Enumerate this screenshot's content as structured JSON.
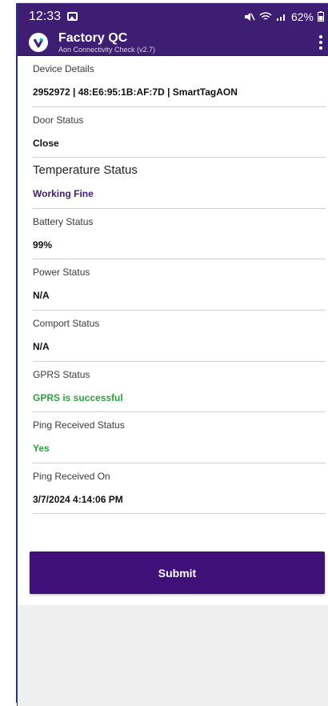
{
  "statusbar": {
    "time": "12:33",
    "battery_pct": "62%"
  },
  "appbar": {
    "title": "Factory QC",
    "subtitle": "Aon Connectivity Check (v2.7)"
  },
  "rows": [
    {
      "label": "Device Details",
      "value": "2952972 | 48:E6:95:1B:AF:7D | SmartTagAON"
    },
    {
      "label": "Door Status",
      "value": "Close"
    },
    {
      "label": "Temperature Status",
      "value": "Working Fine"
    },
    {
      "label": "Battery Status",
      "value": "99%"
    },
    {
      "label": "Power Status",
      "value": "N/A"
    },
    {
      "label": "Comport Status",
      "value": "N/A"
    },
    {
      "label": "GPRS Status",
      "value": "GPRS is successful"
    },
    {
      "label": "Ping Received Status",
      "value": "Yes"
    },
    {
      "label": "Ping Received On",
      "value": "3/7/2024 4:14:06 PM"
    }
  ],
  "submit_label": "Submit",
  "colors": {
    "header": "#3e1e72",
    "button": "#3e1078",
    "purple_value": "#3e1e72",
    "green_value": "#2fa13f"
  }
}
